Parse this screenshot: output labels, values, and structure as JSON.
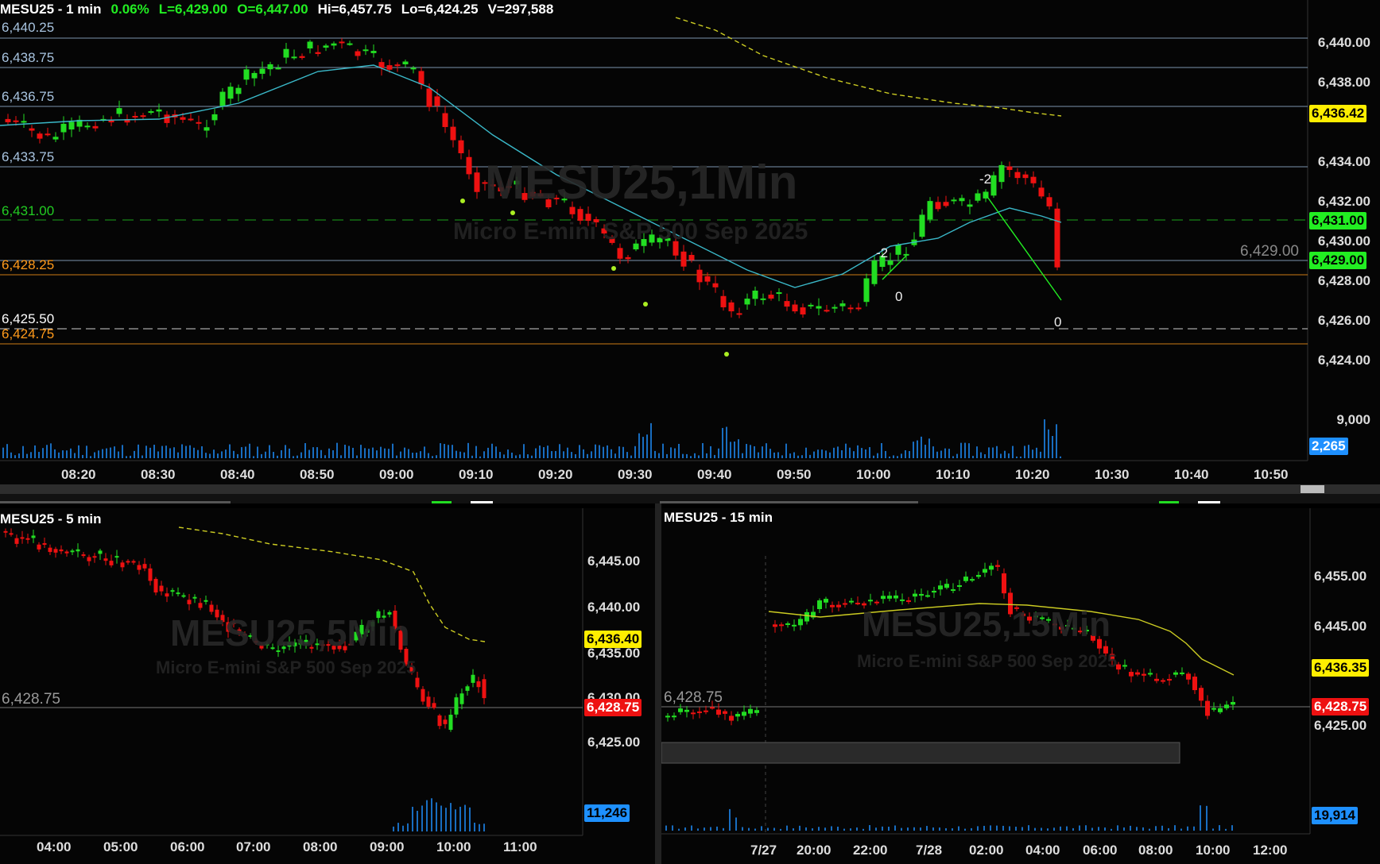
{
  "main": {
    "symbol_interval": "MESU25 - 1 min",
    "change": "0.06%",
    "last": "L=6,429.00",
    "open": "O=6,447.00",
    "high": "Hi=6,457.75",
    "low": "Lo=6,424.25",
    "volume": "V=297,588",
    "watermark_symbol": "MESU25,1Min",
    "watermark_desc": "Micro E-mini S&P 500 Sep 2025",
    "levels": [
      {
        "label": "6,440.25",
        "color": "#9ab8d8"
      },
      {
        "label": "6,438.75",
        "color": "#9ab8d8"
      },
      {
        "label": "6,436.75",
        "color": "#9ab8d8"
      },
      {
        "label": "6,433.75",
        "color": "#9ab8d8"
      },
      {
        "label": "6,431.00",
        "color": "#22cc22"
      },
      {
        "label": "6,428.25",
        "color": "#ff9a1a"
      },
      {
        "label": "6,425.50",
        "color": "#ffffff"
      },
      {
        "label": "6,424.75",
        "color": "#ff9a1a"
      }
    ],
    "price_axis": [
      "6,440.00",
      "6,438.00",
      "6,436.42",
      "6,434.00",
      "6,432.00",
      "6,431.00",
      "6,430.00",
      "6,429.00",
      "6,428.00",
      "6,426.00",
      "6,424.00"
    ],
    "tag_sma": "6,436.42",
    "tag_level": "6,431.00",
    "tag_last": "6,429.00",
    "last_price_grey": "6,429.00",
    "vol_axis": "9,000",
    "vol_tag": "2,265",
    "trade_marks": [
      "-2",
      "0",
      "-2",
      "0"
    ],
    "times": [
      "08:20",
      "08:30",
      "08:40",
      "08:50",
      "09:00",
      "09:10",
      "09:20",
      "09:30",
      "09:40",
      "09:50",
      "10:00",
      "10:10",
      "10:20",
      "10:30",
      "10:40",
      "10:50"
    ]
  },
  "bl": {
    "title": "MESU25 - 5 min",
    "watermark_symbol": "MESU25,5Min",
    "watermark_desc": "Micro E-mini S&P 500 Sep 2025",
    "level_label": "6,428.75",
    "price_axis": [
      "6,445.00",
      "6,440.00",
      "6,435.00",
      "6,430.00",
      "6,425.00"
    ],
    "tag_sma": "6,436.40",
    "tag_last": "6,428.75",
    "vol_tag": "11,246",
    "times": [
      "04:00",
      "05:00",
      "06:00",
      "07:00",
      "08:00",
      "09:00",
      "10:00",
      "11:00"
    ]
  },
  "br": {
    "title": "MESU25 - 15 min",
    "watermark_symbol": "MESU25,15Min",
    "watermark_desc": "Micro E-mini S&P 500 Sep 2025",
    "level_label": "6,428.75",
    "price_axis": [
      "6,455.00",
      "6,445.00",
      "6,425.00"
    ],
    "tag_sma": "6,436.35",
    "tag_last": "6,428.75",
    "vol_tag": "19,914",
    "times": [
      "7/27",
      "20:00",
      "22:00",
      "7/28",
      "02:00",
      "04:00",
      "06:00",
      "08:00",
      "10:00",
      "12:00"
    ]
  },
  "colors": {
    "up": "#22dd22",
    "down": "#ee1111",
    "sma": "#3ab8c8",
    "vwap": "#cccc22",
    "tag_yellow": "#ffee00",
    "tag_green": "#22ee22",
    "tag_red": "#ee1111",
    "tag_blue": "#1e90ff"
  }
}
